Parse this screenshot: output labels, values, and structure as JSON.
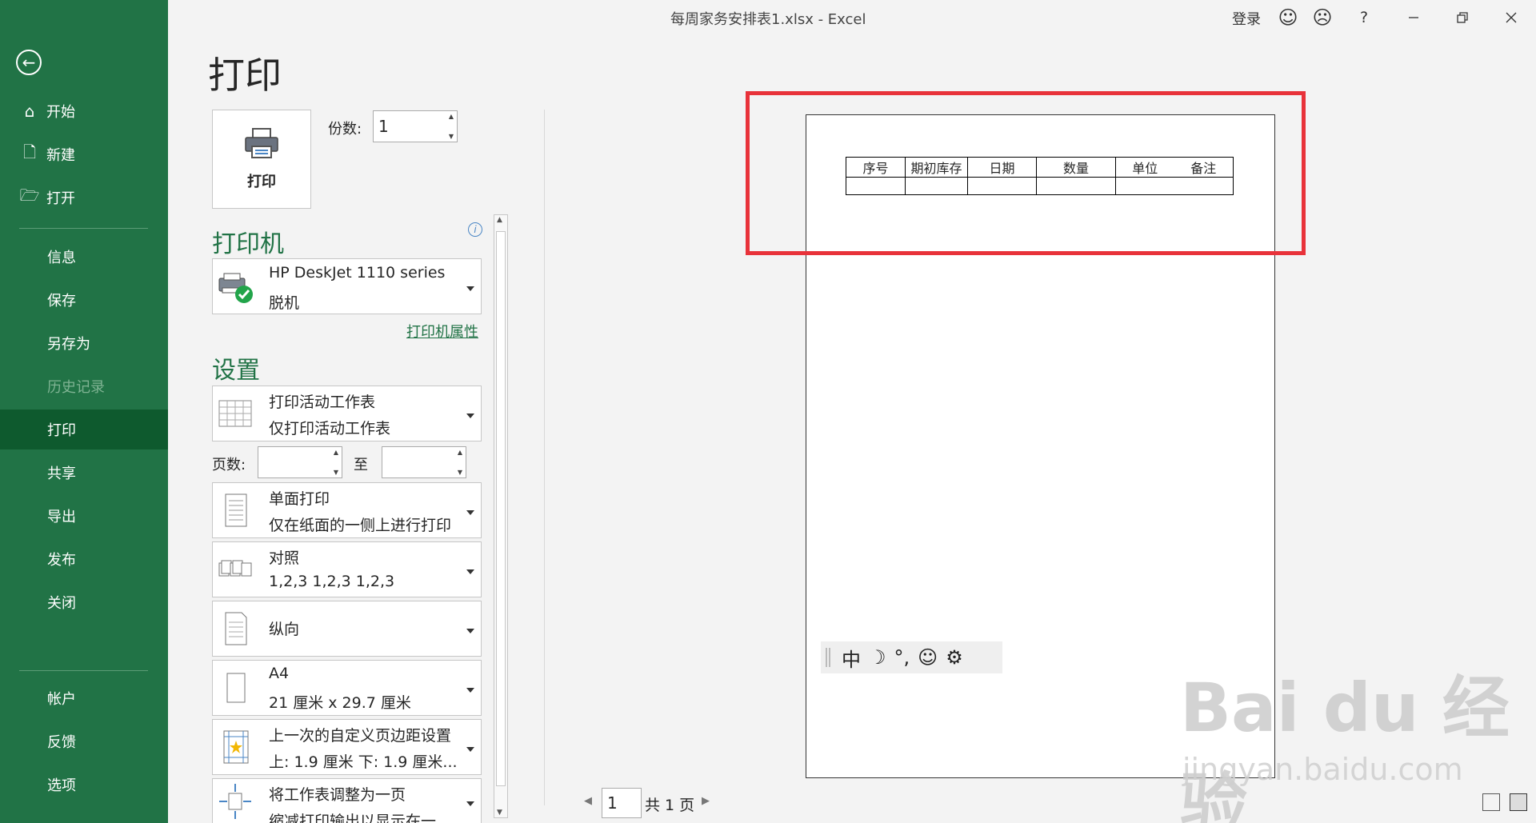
{
  "window": {
    "title": "每周家务安排表1.xlsx  -  Excel",
    "login": "登录",
    "help": "?"
  },
  "nav": {
    "items": [
      {
        "label": "开始",
        "icon": "home-icon"
      },
      {
        "label": "新建",
        "icon": "new-doc-icon"
      },
      {
        "label": "打开",
        "icon": "folder-open-icon"
      },
      {
        "label": "信息"
      },
      {
        "label": "保存"
      },
      {
        "label": "另存为"
      },
      {
        "label": "历史记录"
      },
      {
        "label": "打印"
      },
      {
        "label": "共享"
      },
      {
        "label": "导出"
      },
      {
        "label": "发布"
      },
      {
        "label": "关闭"
      },
      {
        "label": "帐户"
      },
      {
        "label": "反馈"
      },
      {
        "label": "选项"
      }
    ]
  },
  "print": {
    "heading": "打印",
    "button_label": "打印",
    "copies_label": "份数:",
    "copies_value": "1",
    "printer_section": "打印机",
    "printer_name": "HP DeskJet 1110 series",
    "printer_status": "脱机",
    "printer_props": "打印机属性",
    "settings_section": "设置",
    "pages_label": "页数:",
    "to_label": "至",
    "settings": [
      {
        "line1": "打印活动工作表",
        "line2": "仅打印活动工作表"
      },
      {
        "line1": "单面打印",
        "line2": "仅在纸面的一侧上进行打印"
      },
      {
        "line1": "对照",
        "line2": "1,2,3    1,2,3    1,2,3"
      },
      {
        "line1": "纵向",
        "line2": ""
      },
      {
        "line1": "A4",
        "line2": "21 厘米 x 29.7 厘米"
      },
      {
        "line1": "上一次的自定义页边距设置",
        "line2": "上: 1.9 厘米 下: 1.9 厘米..."
      },
      {
        "line1": "将工作表调整为一页",
        "line2": "缩减打印输出以显示在一..."
      }
    ]
  },
  "preview": {
    "headers": [
      "序号",
      "期初库存",
      "日期",
      "数量",
      "单位",
      "备注"
    ],
    "ime": [
      "中",
      "☽",
      "°,",
      "☺",
      "⚙"
    ],
    "page_value": "1",
    "page_total": "共 1 页"
  },
  "watermark": {
    "main": "Bai du 经验",
    "sub": "jingyan.baidu.com"
  },
  "colors": {
    "accent": "#217346",
    "highlight": "#e8323a"
  }
}
